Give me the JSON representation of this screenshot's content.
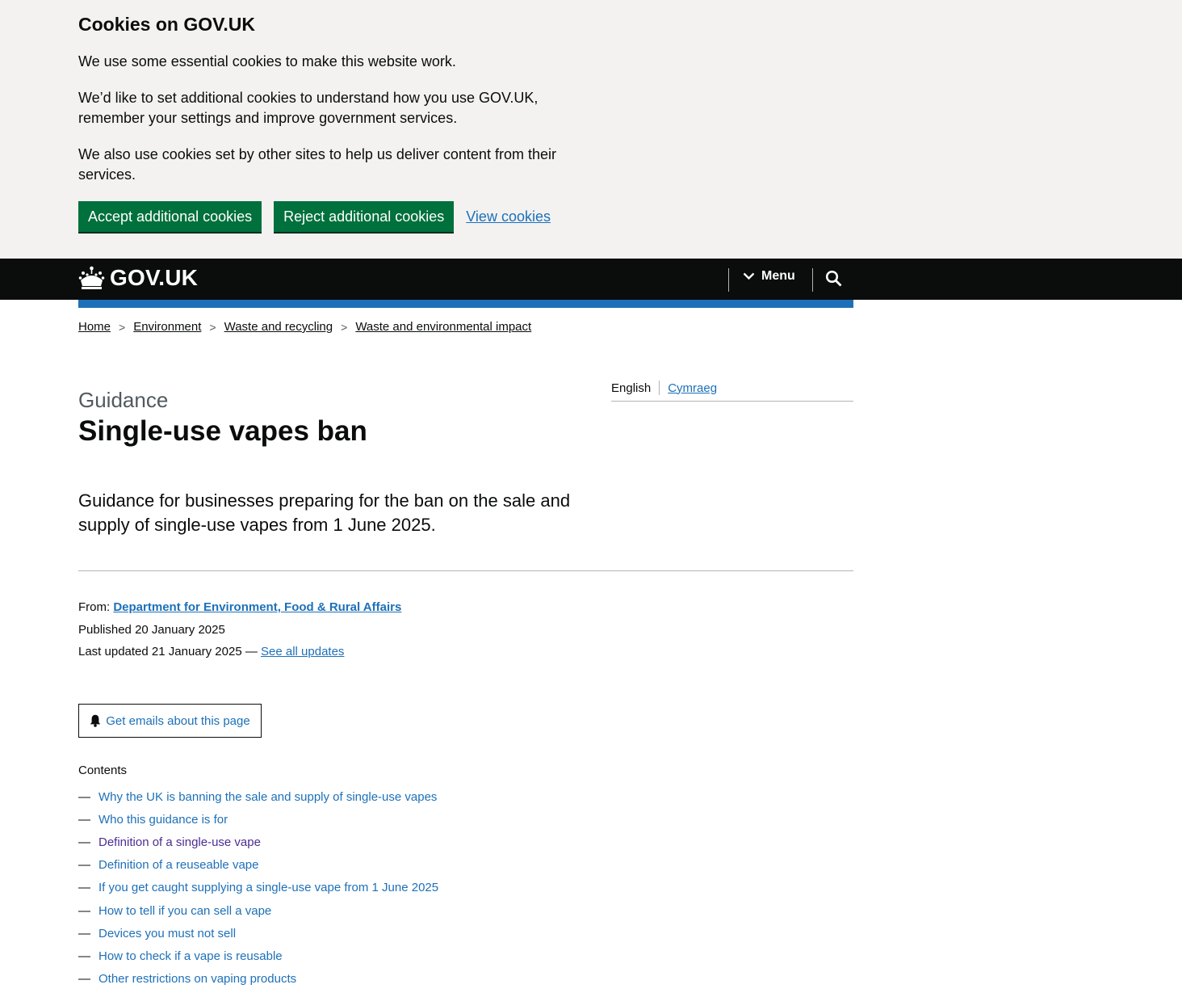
{
  "cookie_banner": {
    "title": "Cookies on GOV.UK",
    "p1": "We use some essential cookies to make this website work.",
    "p2": "We’d like to set additional cookies to understand how you use GOV.UK, remember your settings and improve government services.",
    "p3": "We also use cookies set by other sites to help us deliver content from their services.",
    "accept": "Accept additional cookies",
    "reject": "Reject additional cookies",
    "view": "View cookies"
  },
  "header": {
    "logo": "GOV.UK",
    "menu": "Menu"
  },
  "breadcrumb": [
    "Home",
    "Environment",
    "Waste and recycling",
    "Waste and environmental impact"
  ],
  "language": {
    "current": "English",
    "other": "Cymraeg"
  },
  "page": {
    "caption": "Guidance",
    "title": "Single-use vapes ban",
    "lead": "Guidance for businesses preparing for the ban on the sale and supply of single-use vapes from 1 June 2025."
  },
  "meta": {
    "from_label": "From:",
    "from": "Department for Environment, Food & Rural Affairs",
    "published_label": "Published",
    "published": "20 January 2025",
    "updated_label": "Last updated",
    "updated": "21 January 2025 —",
    "see_updates": "See all updates"
  },
  "email_button": "Get emails about this page",
  "contents": {
    "label": "Contents",
    "items": [
      "Why the UK is banning the sale and supply of single-use vapes",
      "Who this guidance is for",
      "Definition of a single-use vape",
      "Definition of a reuseable vape",
      "If you get caught supplying a single-use vape from 1 June 2025",
      "How to tell if you can sell a vape",
      "Devices you must not sell",
      "How to check if a vape is reusable",
      "Other restrictions on vaping products"
    ]
  },
  "colors": {
    "link": "#1d70b8",
    "visited": "#4c2c92",
    "button": "#00703c",
    "header": "#0b0c0c",
    "banner": "#f3f2f1"
  }
}
